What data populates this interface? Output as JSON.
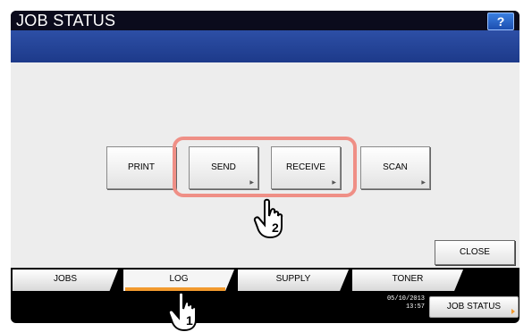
{
  "window": {
    "title": "JOB STATUS",
    "help_label": "?"
  },
  "functions": {
    "print": "PRINT",
    "send": "SEND",
    "receive": "RECEIVE",
    "scan": "SCAN"
  },
  "close_label": "CLOSE",
  "tabs": [
    {
      "label": "JOBS"
    },
    {
      "label": "LOG",
      "active": true
    },
    {
      "label": "SUPPLY"
    },
    {
      "label": "TONER"
    }
  ],
  "footer": {
    "date": "05/10/2013",
    "time": "13:57",
    "job_status_label": "JOB STATUS"
  },
  "callouts": {
    "step1": "1",
    "step2": "2"
  },
  "colors": {
    "accent": "#f29a2e",
    "highlight": "#ef8f86",
    "band": "#2d4fa6"
  }
}
